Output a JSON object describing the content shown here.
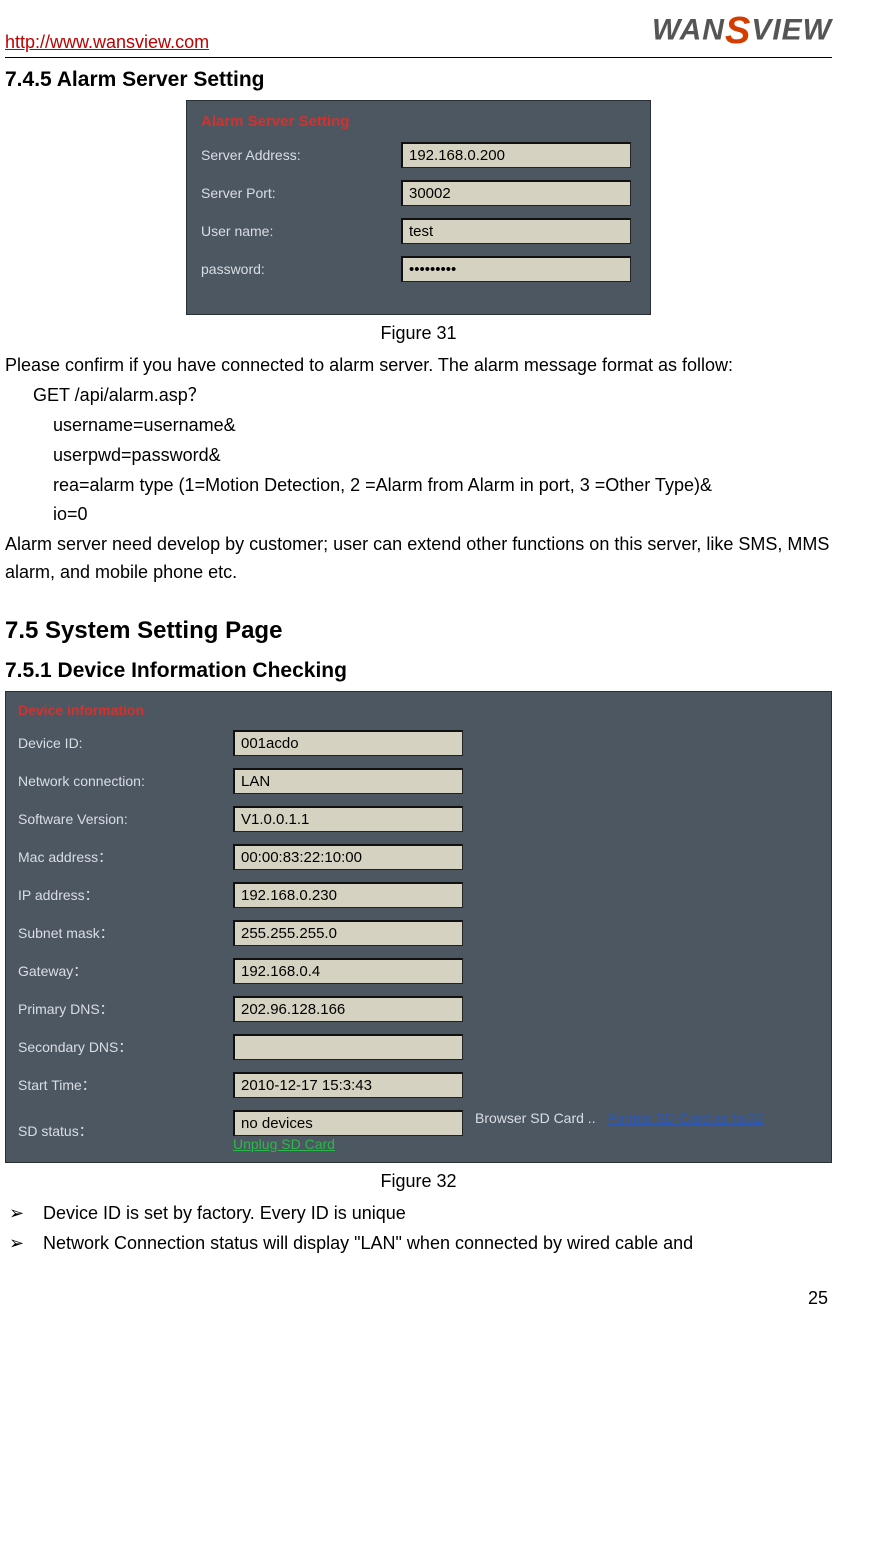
{
  "header": {
    "url": "http://www.wansview.com",
    "logo": "WANSVIEW"
  },
  "sec745": {
    "heading": "7.4.5   Alarm Server Setting",
    "panel_title": "Alarm Server Setting",
    "fields": {
      "server_address": {
        "label": "Server Address:",
        "value": "192.168.0.200"
      },
      "server_port": {
        "label": "Server Port:",
        "value": "30002"
      },
      "username": {
        "label": "User name:",
        "value": "test"
      },
      "password": {
        "label": "password:",
        "value": "•••••••••"
      }
    },
    "caption": "Figure 31",
    "intro": "Please confirm if you have connected to alarm server. The alarm message format as follow:",
    "code": {
      "l1": "GET /api/alarm.asp？",
      "l2": "username=username&",
      "l3": "userpwd=password&",
      "l4": "rea=alarm type (1=Motion Detection, 2 =Alarm from Alarm in port, 3 =Other Type)&",
      "l5": "io=0"
    },
    "note": "Alarm server need develop by customer; user can extend other functions on this server, like SMS, MMS alarm, and mobile phone etc."
  },
  "sec75": {
    "heading": "7.5   System Setting Page"
  },
  "sec751": {
    "heading": "7.5.1   Device Information Checking",
    "panel_title": "Device information",
    "fields": {
      "device_id": {
        "label": "Device ID:",
        "value": "001acdo"
      },
      "network": {
        "label": "Network connection:",
        "value": "LAN"
      },
      "software": {
        "label": "Software Version:",
        "value": "V1.0.0.1.1"
      },
      "mac": {
        "label": "Mac address：",
        "value": "00:00:83:22:10:00"
      },
      "ip": {
        "label": "IP address：",
        "value": "192.168.0.230"
      },
      "subnet": {
        "label": "Subnet mask：",
        "value": "255.255.255.0"
      },
      "gateway": {
        "label": "Gateway：",
        "value": "192.168.0.4"
      },
      "pdns": {
        "label": "Primary DNS：",
        "value": "202.96.128.166"
      },
      "sdns": {
        "label": "Secondary DNS：",
        "value": ""
      },
      "start": {
        "label": "Start Time：",
        "value": "2010-12-17 15:3:43"
      },
      "sd": {
        "label": "SD status：",
        "value": "no devices"
      }
    },
    "links": {
      "browser": "Browser SD Card ..",
      "format": "Format SD Card as fat32",
      "unplug": "Unplug SD Card"
    },
    "caption": "Figure 32",
    "bullets": {
      "b1": "Device ID is set by factory. Every ID is unique",
      "b2": "Network Connection status will display \"LAN\" when connected by wired cable and"
    }
  },
  "page_number": "25"
}
